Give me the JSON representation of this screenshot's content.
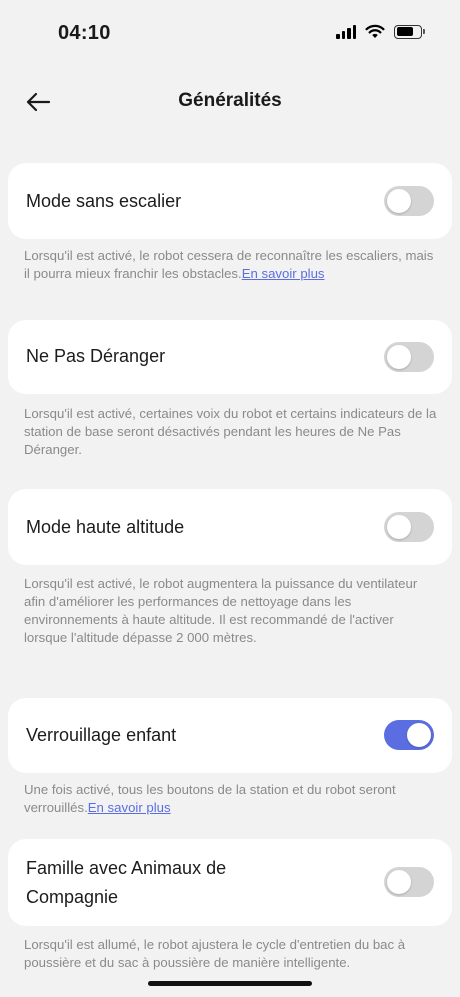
{
  "status_bar": {
    "time": "04:10",
    "icons": [
      "signal-icon",
      "wifi-icon",
      "battery-icon"
    ]
  },
  "header": {
    "back_icon": "arrow-left-icon",
    "title": "Généralités"
  },
  "settings": [
    {
      "label": "Mode sans escalier",
      "enabled": false,
      "description": "Lorsqu'il est activé, le robot cessera de reconnaître les escaliers, mais il pourra mieux franchir les obstacles.",
      "link": "En savoir plus"
    },
    {
      "label": "Ne Pas Déranger",
      "enabled": false,
      "description": "Lorsqu'il est activé, certaines voix du robot et certains indicateurs de la station de base seront désactivés pendant les heures de Ne Pas Déranger."
    },
    {
      "label": "Mode haute altitude",
      "enabled": false,
      "description": "Lorsqu'il est activé, le robot augmentera la puissance du ventilateur afin d'améliorer les performances de nettoyage dans les environnements à haute altitude. Il est recommandé de l'activer lorsque l'altitude dépasse 2 000 mètres."
    },
    {
      "label": "Verrouillage enfant",
      "enabled": true,
      "description": "Une fois activé, tous les boutons de la station et du robot seront verrouillés.",
      "link": "En savoir plus"
    },
    {
      "label": "Famille avec Animaux de Compagnie",
      "enabled": false,
      "description": "Lorsqu'il est allumé, le robot ajustera le cycle d'entretien du bac à poussière et du sac à poussière de manière intelligente."
    }
  ],
  "colors": {
    "accent": "#5b6ee1",
    "toggle_off": "#d4d4d4",
    "background": "#f2f2f2",
    "description_text": "#8a8a8a"
  }
}
